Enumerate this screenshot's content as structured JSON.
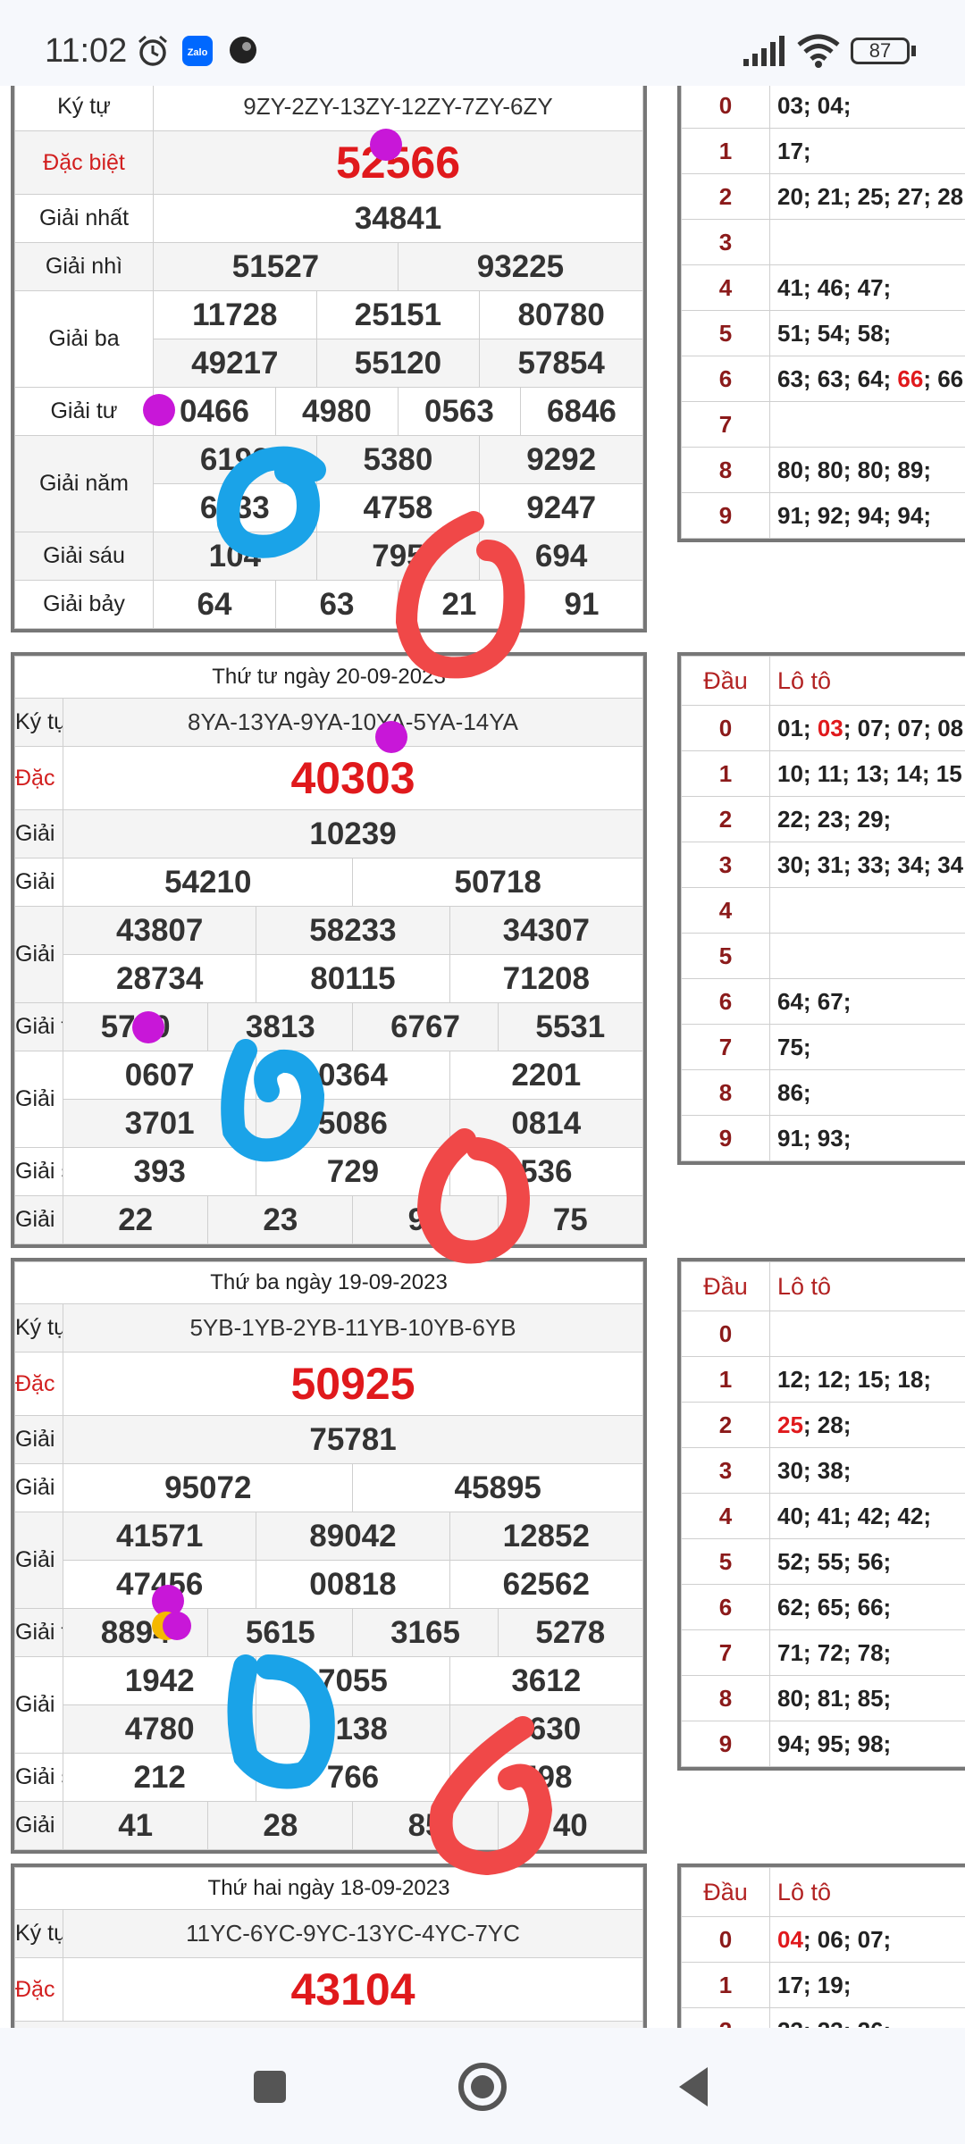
{
  "status_bar": {
    "time": "11:02",
    "battery": "87",
    "icons": [
      "alarm-icon",
      "zalo-icon",
      "app-icon",
      "signal-icon",
      "wifi-icon",
      "battery-icon"
    ]
  },
  "labels": {
    "ky_tu": "Ký tự",
    "dac_biet": "Đặc biệt",
    "nhat": "Giải nhất",
    "nhi": "Giải nhì",
    "ba": "Giải ba",
    "tu": "Giải tư",
    "nam": "Giải năm",
    "sau": "Giải sáu",
    "bay": "Giải bảy",
    "dau": "Đầu",
    "loto": "Lô tô"
  },
  "results": [
    {
      "header": "",
      "ky_tu": "9ZY-2ZY-13ZY-12ZY-7ZY-6ZY",
      "dac_biet": "52566",
      "nhat": "34841",
      "nhi": [
        "51527",
        "93225"
      ],
      "ba": [
        "11728",
        "25151",
        "80780",
        "49217",
        "55120",
        "57854"
      ],
      "tu": [
        "0466",
        "4980",
        "0563",
        "6846"
      ],
      "nam": [
        "6192",
        "5380",
        "9292",
        "6733",
        "4758",
        "9247"
      ],
      "sau": [
        "104",
        "795",
        "694"
      ],
      "bay": [
        "64",
        "63",
        "21",
        "91"
      ]
    },
    {
      "header": "Thứ tư ngày 20-09-2023",
      "ky_tu": "8YA-13YA-9YA-10YA-5YA-14YA",
      "dac_biet": "40303",
      "nhat": "10239",
      "nhi": [
        "54210",
        "50718"
      ],
      "ba": [
        "43807",
        "58233",
        "34307",
        "28734",
        "80115",
        "71208"
      ],
      "tu": [
        "5730",
        "3813",
        "6767",
        "5531"
      ],
      "nam": [
        "0607",
        "0364",
        "2201",
        "3701",
        "5086",
        "0814"
      ],
      "sau": [
        "393",
        "729",
        "536"
      ],
      "bay": [
        "22",
        "23",
        "91",
        "75"
      ]
    },
    {
      "header": "Thứ ba ngày 19-09-2023",
      "ky_tu": "5YB-1YB-2YB-11YB-10YB-6YB",
      "dac_biet": "50925",
      "nhat": "75781",
      "nhi": [
        "95072",
        "45895"
      ],
      "ba": [
        "41571",
        "89042",
        "12852",
        "47456",
        "00818",
        "62562"
      ],
      "tu": [
        "8894",
        "5615",
        "3165",
        "5278"
      ],
      "nam": [
        "1942",
        "7055",
        "3612",
        "4780",
        "5138",
        "3630"
      ],
      "sau": [
        "212",
        "766",
        "598"
      ],
      "bay": [
        "41",
        "28",
        "85",
        "40"
      ]
    },
    {
      "header": "Thứ hai ngày 18-09-2023",
      "ky_tu": "11YC-6YC-9YC-13YC-4YC-7YC",
      "dac_biet": "43104"
    }
  ],
  "loto": [
    {
      "rows": [
        {
          "d": "0",
          "v": [
            "03; 04;"
          ]
        },
        {
          "d": "1",
          "v": [
            "17;"
          ]
        },
        {
          "d": "2",
          "v": [
            "20; 21; 25; 27; 28"
          ]
        },
        {
          "d": "3",
          "v": [
            ""
          ]
        },
        {
          "d": "4",
          "v": [
            "41; 46; 47;"
          ]
        },
        {
          "d": "5",
          "v": [
            "51; 54; 58;"
          ]
        },
        {
          "d": "6",
          "v": [
            "63; 63; 64; ",
            "66",
            "; 66"
          ]
        },
        {
          "d": "7",
          "v": [
            ""
          ]
        },
        {
          "d": "8",
          "v": [
            "80; 80; 80; 89;"
          ]
        },
        {
          "d": "9",
          "v": [
            "91; 92; 94; 94;"
          ]
        }
      ]
    },
    {
      "rows": [
        {
          "d": "0",
          "v": [
            "01; ",
            "03",
            "; 07; 07; 08"
          ]
        },
        {
          "d": "1",
          "v": [
            "10; 11; 13; 14; 15"
          ]
        },
        {
          "d": "2",
          "v": [
            "22; 23; 29;"
          ]
        },
        {
          "d": "3",
          "v": [
            "30; 31; 33; 34; 34"
          ]
        },
        {
          "d": "4",
          "v": [
            ""
          ]
        },
        {
          "d": "5",
          "v": [
            ""
          ]
        },
        {
          "d": "6",
          "v": [
            "64; 67;"
          ]
        },
        {
          "d": "7",
          "v": [
            "75;"
          ]
        },
        {
          "d": "8",
          "v": [
            "86;"
          ]
        },
        {
          "d": "9",
          "v": [
            "91; 93;"
          ]
        }
      ]
    },
    {
      "rows": [
        {
          "d": "0",
          "v": [
            ""
          ]
        },
        {
          "d": "1",
          "v": [
            "12; 12; 15; 18;"
          ]
        },
        {
          "d": "2",
          "v": [
            "",
            "25",
            "; 28;"
          ]
        },
        {
          "d": "3",
          "v": [
            "30; 38;"
          ]
        },
        {
          "d": "4",
          "v": [
            "40; 41; 42; 42;"
          ]
        },
        {
          "d": "5",
          "v": [
            "52; 55; 56;"
          ]
        },
        {
          "d": "6",
          "v": [
            "62; 65; 66;"
          ]
        },
        {
          "d": "7",
          "v": [
            "71; 72; 78;"
          ]
        },
        {
          "d": "8",
          "v": [
            "80; 81; 85;"
          ]
        },
        {
          "d": "9",
          "v": [
            "94; 95; 98;"
          ]
        }
      ]
    },
    {
      "rows": [
        {
          "d": "0",
          "v": [
            "",
            "04",
            "; 06; 07;"
          ]
        },
        {
          "d": "1",
          "v": [
            "17; 19;"
          ]
        },
        {
          "d": "2",
          "v": [
            "23; 23; 26;"
          ]
        }
      ]
    }
  ],
  "colors": {
    "accent_red": "#e0191c",
    "dau_red": "#8b1a1a",
    "scribble_blue": "#1aa3e8",
    "scribble_red": "#f04848",
    "dot_purple": "#c817d8"
  },
  "nav": {
    "icons": [
      "recents-square-icon",
      "home-circle-icon",
      "back-triangle-icon"
    ]
  }
}
